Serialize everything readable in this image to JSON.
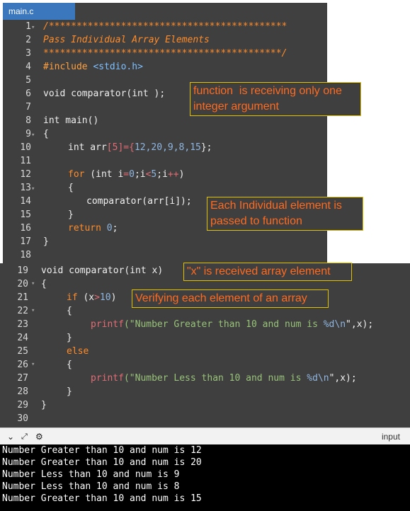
{
  "tab": {
    "label": "main.c"
  },
  "code": {
    "l1": "/*******************************************",
    "l2": "Pass Individual Array Elements",
    "l3": "*******************************************/",
    "l4_pp": "#include",
    "l4_hdr": "<stdio.h>",
    "l6": "void comparator(int );",
    "l8": "int main()",
    "l9": "{",
    "l10_a": "int arr",
    "l10_b": "[5]",
    "l10_c": "={",
    "l10_d": "12,20,9,8,15",
    "l10_e": "};",
    "l12_a": "for",
    "l12_b": " (int i",
    "l12_c": "=",
    "l12_d": "0",
    "l12_e": ";i",
    "l12_f": "<",
    "l12_g": "5",
    "l12_h": ";i",
    "l12_i": "++",
    "l12_j": ")",
    "l13": "{",
    "l14": "comparator(arr[i]);",
    "l15": "}",
    "l16_a": "return",
    "l16_b": " 0",
    "l16_c": ";",
    "l17": "}",
    "l19": "void comparator(int x)",
    "l20": "{",
    "l21_a": "if",
    "l21_b": " (x",
    "l21_c": ">",
    "l21_d": "10",
    "l21_e": ")",
    "l22": "{",
    "l23_a": "printf",
    "l23_b": "(\"Number Greater than 10 and num is ",
    "l23_c": "%d\\n",
    "l23_d": "\",x);",
    "l24": "}",
    "l25": "else",
    "l26": "{",
    "l27_a": "printf",
    "l27_b": "(\"Number Less than 10 and num is ",
    "l27_c": "%d\\n",
    "l27_d": "\",x);",
    "l28": "}",
    "l29": "}"
  },
  "line_numbers": [
    "1",
    "2",
    "3",
    "4",
    "5",
    "6",
    "7",
    "8",
    "9",
    "10",
    "11",
    "12",
    "13",
    "14",
    "15",
    "16",
    "17",
    "18",
    "19",
    "20",
    "21",
    "22",
    "23",
    "24",
    "25",
    "26",
    "27",
    "28",
    "29",
    "30"
  ],
  "annotations": {
    "a1": "function  is receiving only one\ninteger argument",
    "a2": "Each Individual element is\npassed to function",
    "a3": "\"x\" is received array element",
    "a4": "Verifying each element of an array"
  },
  "io_bar": {
    "input_label": "input"
  },
  "output": [
    "Number Greater than 10 and num is 12",
    "Number Greater than 10 and num is 20",
    "Number Less than 10 and num is 9",
    "Number Less than 10 and num is 8",
    "Number Greater than 10 and num is 15"
  ]
}
